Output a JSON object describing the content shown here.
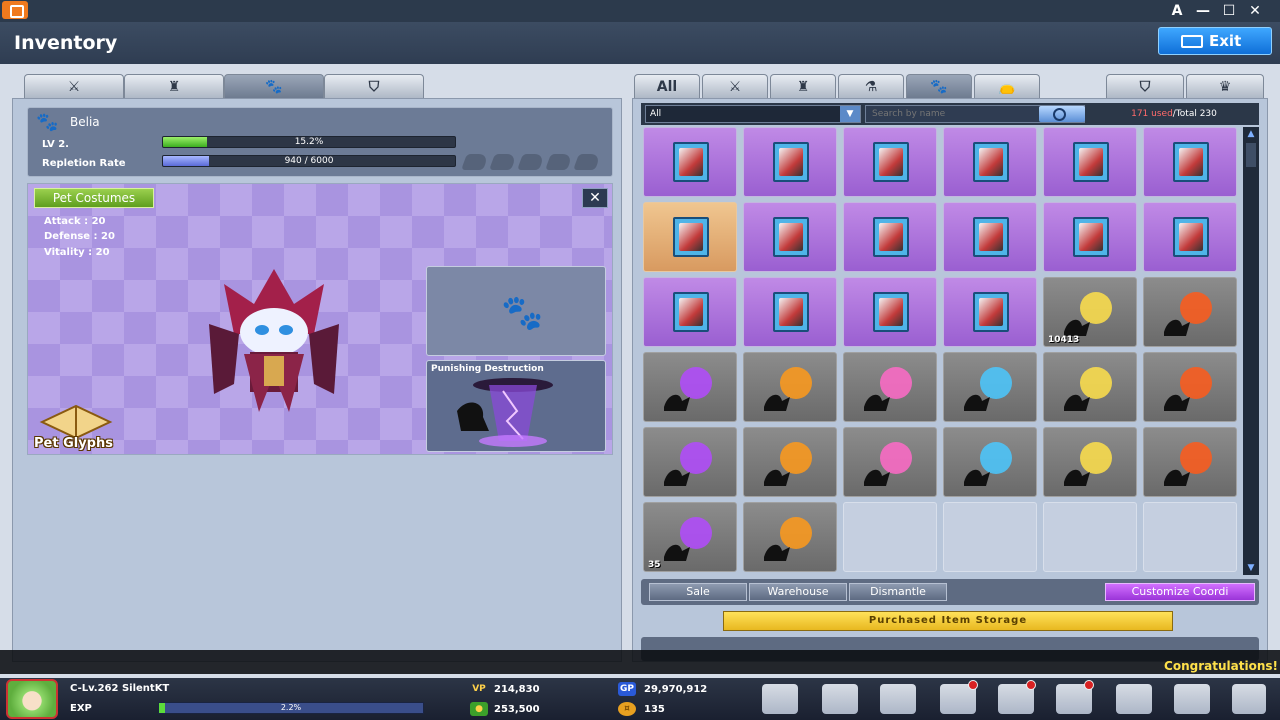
{
  "window": {
    "minimize": "—",
    "maximize": "☐",
    "close": "✕",
    "font": "A"
  },
  "header": {
    "title": "Inventory",
    "exit_label": "Exit"
  },
  "left_tabs": [
    {
      "icon": "crossed-swords-icon",
      "glyph": "⚔"
    },
    {
      "icon": "armor-icon",
      "glyph": "♜"
    },
    {
      "icon": "paw-icon",
      "glyph": "🐾"
    },
    {
      "icon": "shield-icon",
      "glyph": "⛉"
    }
  ],
  "pet": {
    "name": "Belia",
    "level_label": "LV 2.",
    "level_progress": "15.2%",
    "level_fraction": 0.152,
    "repletion_label": "Repletion Rate",
    "repletion_value": "940 / 6000",
    "repletion_fraction": 0.157
  },
  "costumes": {
    "button_label": "Pet Costumes",
    "close_label": "✕",
    "stats": [
      "Attack : 20",
      "Defense : 20",
      "Vitality : 20"
    ],
    "skill_name": "Punishing Destruction",
    "glyphs_label": "Pet Glyphs"
  },
  "right_tabs": [
    {
      "label": "All",
      "glyph": "All"
    },
    {
      "icon": "crossed-swords-icon",
      "glyph": "⚔"
    },
    {
      "icon": "armor-icon",
      "glyph": "♜"
    },
    {
      "icon": "potion-icon",
      "glyph": "⚗"
    },
    {
      "icon": "paw-icon",
      "glyph": "🐾"
    },
    {
      "icon": "bag-icon",
      "glyph": "👝"
    },
    {
      "icon": "shield-icon",
      "glyph": "⛉"
    },
    {
      "icon": "helmet-icon",
      "glyph": "♛"
    }
  ],
  "filter": {
    "selected": "All",
    "search_placeholder": "Search by name",
    "used": "171 used",
    "total": "/Total 230"
  },
  "grid": {
    "rows": [
      [
        "purple",
        "purple",
        "purple",
        "purple",
        "purple",
        "purple"
      ],
      [
        "orange",
        "purple",
        "purple",
        "purple",
        "purple",
        "purple"
      ],
      [
        "purple",
        "purple",
        "purple",
        "purple",
        "gray",
        "gray"
      ],
      [
        "gray",
        "gray",
        "gray",
        "gray",
        "gray",
        "gray"
      ],
      [
        "gray",
        "gray",
        "gray",
        "gray",
        "gray",
        "gray"
      ],
      [
        "gray",
        "gray",
        "empty",
        "empty",
        "empty",
        "empty"
      ]
    ],
    "counts": {
      "2-4": "10413",
      "5-0": "35"
    }
  },
  "actions": {
    "sale": "Sale",
    "warehouse": "Warehouse",
    "dismantle": "Dismantle",
    "customize": "Customize Coordi"
  },
  "storage_label": "Purchased Item Storage",
  "notice": "Congratulations!",
  "character": {
    "name": "C-Lv.262 SilentKT",
    "exp_label": "EXP",
    "exp_percent": "2.2%",
    "exp_fraction": 0.022
  },
  "currencies": {
    "vp_label": "VP",
    "vp": "214,830",
    "gold": "253,500",
    "gp_label": "GP",
    "gp": "29,970,912",
    "coin": "135"
  },
  "colors": {
    "accent": "#1a8cff",
    "purple_cell": "#b57ae0",
    "notice_text": "#ffe14a"
  }
}
